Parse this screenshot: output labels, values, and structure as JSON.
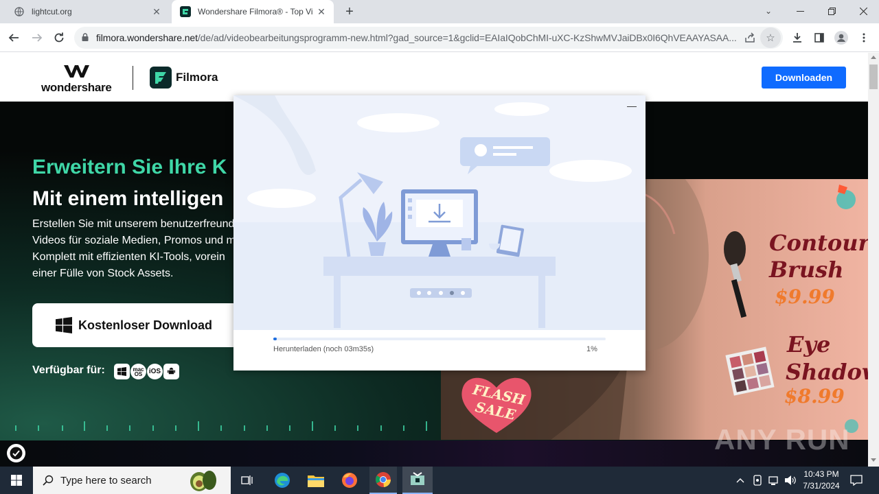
{
  "browser": {
    "tabs": [
      {
        "title": "lightcut.org"
      },
      {
        "title": "Wondershare Filmora® - Top Vi"
      }
    ],
    "url_host": "filmora.wondershare.net",
    "url_path": "/de/ad/videobearbeitungsprogramm-new.html?gad_source=1&gclid=EAIaIQobChMI-uXC-KzShwMVJaiDBx0I6QhVEAAYASAA..."
  },
  "site": {
    "brand": "wondershare",
    "product": "Filmora",
    "download_button": "Downloaden"
  },
  "hero": {
    "heading_green": "Erweitern Sie Ihre K",
    "heading_white": "Mit einem intelligen",
    "body": [
      "Erstellen Sie mit unserem benutzerfreund",
      "Videos für soziale Medien, Promos und m",
      "Komplett mit effizienten KI-Tools, vorein",
      "einer Fülle von Stock Assets."
    ],
    "cta": "Kostenloser Download",
    "available_label": "Verfügbar für:",
    "platforms": [
      "windows-icon",
      "macos-icon",
      "ios-icon",
      "android-icon"
    ],
    "platform_labels": {
      "macos": "mac\nOS",
      "ios": "iOS"
    }
  },
  "ad": {
    "flash_sale": "FLASH SALE",
    "item1_line1": "Contour",
    "item1_line2": "Brush",
    "item1_price": "$9.99",
    "item2_line1": "Eye",
    "item2_line2": "Shadow",
    "item2_price": "$8.99"
  },
  "dialog": {
    "status": "Herunterladen (noch 03m35s)",
    "percent": "1%",
    "progress": 0.01,
    "minimize": "—"
  },
  "watermark": "ANY RUN",
  "taskbar": {
    "search_placeholder": "Type here to search",
    "time": "10:43 PM",
    "date": "7/31/2024"
  },
  "colors": {
    "accent_blue": "#0f6bff",
    "hero_green": "#3fd7a7",
    "progress_blue": "#1f6fe0"
  }
}
